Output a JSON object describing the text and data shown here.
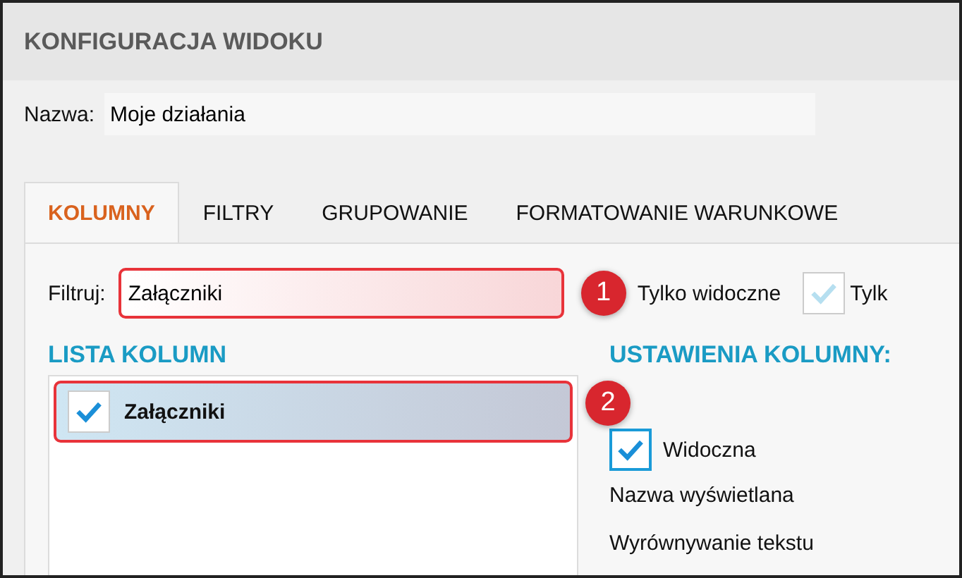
{
  "window": {
    "title": "KONFIGURACJA WIDOKU"
  },
  "name_field": {
    "label": "Nazwa:",
    "value": "Moje działania"
  },
  "tabs": [
    {
      "label": "KOLUMNY",
      "selected": true
    },
    {
      "label": "FILTRY",
      "selected": false
    },
    {
      "label": "GRUPOWANIE",
      "selected": false
    },
    {
      "label": "FORMATOWANIE WARUNKOWE",
      "selected": false
    }
  ],
  "filter": {
    "label": "Filtruj:",
    "value": "Załączniki",
    "callout": "1"
  },
  "filter_options": [
    {
      "label": "Tylko widoczne"
    },
    {
      "label": "Tylk",
      "checked": true,
      "disabled": true
    }
  ],
  "column_list": {
    "title": "LISTA KOLUMN",
    "callout": "2",
    "items": [
      {
        "label": "Załączniki",
        "checked": true,
        "selected": true
      }
    ]
  },
  "column_settings": {
    "title": "USTAWIENIA KOLUMNY:",
    "visible": {
      "label": "Widoczna",
      "checked": true
    },
    "fields": [
      "Nazwa wyświetlana",
      "Wyrównywanie tekstu"
    ]
  }
}
